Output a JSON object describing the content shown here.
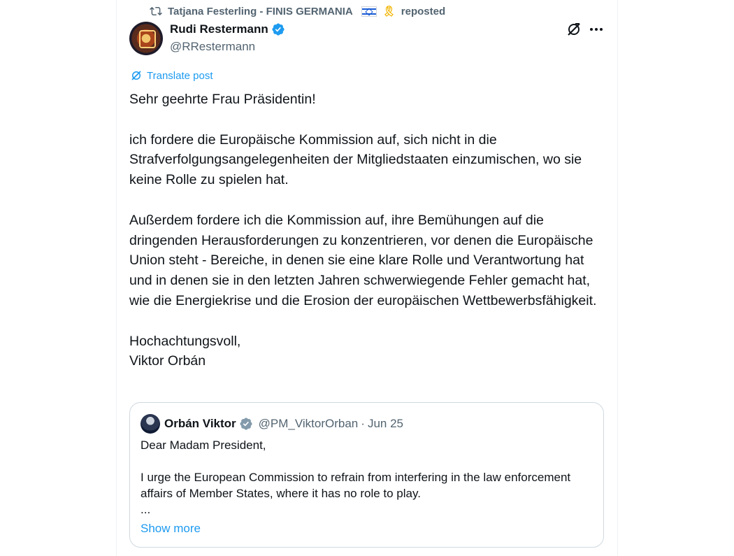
{
  "repost": {
    "reposter_name": "Tatjana Festerling - FINIS GERMANIA",
    "ribbon_emoji": "🎗",
    "action_text": "reposted"
  },
  "post": {
    "author_name": "Rudi Restermann",
    "author_handle": "@RRestermann",
    "translate_label": "Translate post",
    "paragraphs": {
      "p1": "Sehr geehrte Frau Präsidentin!",
      "p2": "ich fordere die Europäische Kommission auf, sich nicht in die Strafverfolgungsangelegenheiten der Mitgliedstaaten einzumischen, wo sie keine Rolle zu spielen hat.",
      "p3": "Außerdem fordere ich die Kommission auf, ihre Bemühungen auf die dringenden Herausforderungen zu konzentrieren, vor denen die Europäische Union steht - Bereiche, in denen sie eine klare Rolle und Verantwortung hat und in denen sie in den letzten Jahren schwerwiegende Fehler gemacht hat, wie die Energiekrise und die Erosion der europäischen Wettbewerbsfähigkeit.",
      "closing": "Hochachtungsvoll,",
      "signature": "Viktor Orbán"
    }
  },
  "quote": {
    "author_name": "Orbán Viktor",
    "author_handle": "@PM_ViktorOrban",
    "separator": "·",
    "date": "Jun 25",
    "line1": "Dear Madam President,",
    "line2": "I urge the European Commission to refrain from interfering in the law enforcement affairs of Member States, where it has no role to play.",
    "ellipsis": "...",
    "show_more": "Show more"
  },
  "icons": {
    "repost": "repost-icon",
    "verified": "verified-badge-icon",
    "verified_gray": "gray-verified-badge-icon",
    "grok": "grok-icon",
    "more": "more-icon",
    "translate": "translate-icon",
    "flag": "israel-flag-icon"
  },
  "colors": {
    "accent": "#1d9bf0",
    "text": "#0f1419",
    "secondary": "#536471",
    "border": "#cfd9de",
    "gov_badge": "#829aab"
  }
}
